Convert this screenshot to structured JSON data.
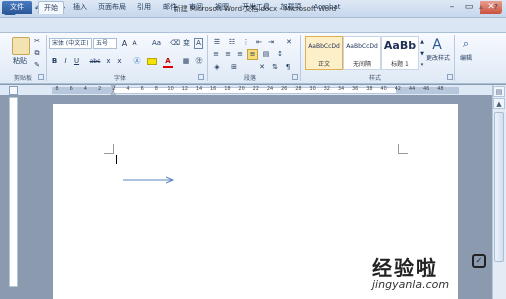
{
  "window": {
    "title": "新建 Microsoft Word 文档.docx - Microsoft Word"
  },
  "tabs": [
    "文件",
    "开始",
    "插入",
    "页面布局",
    "引用",
    "邮件",
    "审阅",
    "视图",
    "开发工具",
    "加载项",
    "Acrobat"
  ],
  "active_tab": "开始",
  "ribbon": {
    "clipboard": {
      "paste_label": "粘贴",
      "group_label": "剪贴板"
    },
    "font": {
      "font_name": "宋体 (中文正)",
      "font_size": "五号",
      "grow": "A",
      "shrink": "A",
      "case": "Aa",
      "phonetic": "变",
      "border": "A",
      "bold": "B",
      "italic": "I",
      "underline": "U",
      "strike": "abc",
      "subscript": "x",
      "superscript": "x",
      "group_label": "字体"
    },
    "paragraph": {
      "group_label": "段落"
    },
    "styles": {
      "items": [
        {
          "preview": "AaBbCcDd",
          "name": "正文"
        },
        {
          "preview": "AaBbCcDd",
          "name": "无间隔"
        },
        {
          "preview": "AaBb",
          "name": "标题 1"
        }
      ],
      "change_styles_label": "更改样式",
      "group_label": "样式"
    },
    "editing": {
      "label": "编辑"
    }
  },
  "ruler": {
    "numbers": [
      "8",
      "6",
      "4",
      "2",
      "2",
      "4",
      "6",
      "8",
      "10",
      "12",
      "14",
      "16",
      "18",
      "20",
      "22",
      "24",
      "26",
      "28",
      "30",
      "32",
      "34",
      "36",
      "38",
      "40",
      "42",
      "44",
      "46",
      "48"
    ]
  },
  "watermark": {
    "line1": "经验啦",
    "line2": "jingyanla.com"
  },
  "colors": {
    "arrow": "#5b86c6",
    "file_tab": "#2b5797",
    "watermark": "#222222"
  }
}
